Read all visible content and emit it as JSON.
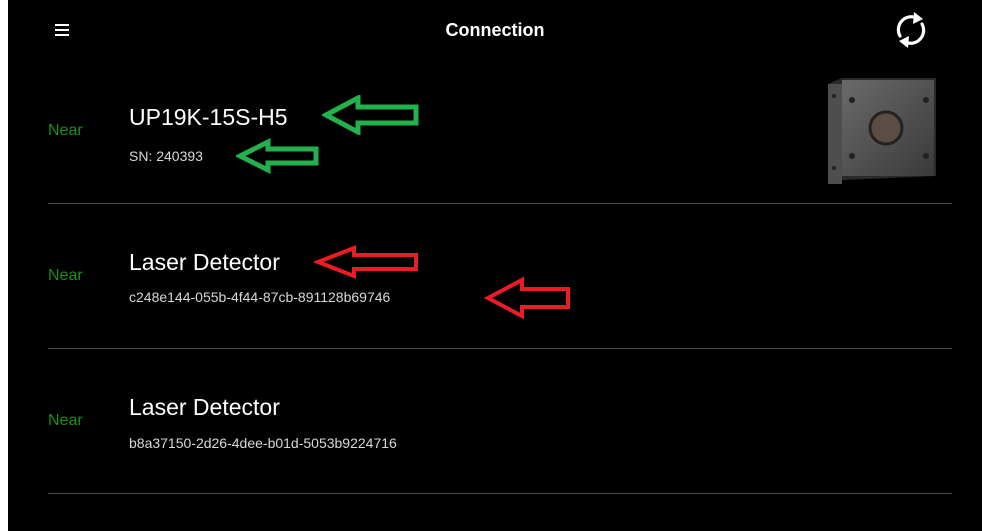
{
  "header": {
    "title": "Connection",
    "menu_icon": "hamburger-menu-icon",
    "refresh_icon": "refresh-icon"
  },
  "devices": [
    {
      "proximity": "Near",
      "name": "UP19K-15S-H5",
      "subtitle": "SN: 240393",
      "has_image": true
    },
    {
      "proximity": "Near",
      "name": "Laser Detector",
      "subtitle": "c248e144-055b-4f44-87cb-891128b69746",
      "has_image": false
    },
    {
      "proximity": "Near",
      "name": "Laser Detector",
      "subtitle": "b8a37150-2d26-4dee-b01d-5053b9224716",
      "has_image": false
    }
  ],
  "annotations": {
    "green_color": "#22b14c",
    "red_color": "#ed1c24",
    "near_color": "#1a8f1a"
  }
}
